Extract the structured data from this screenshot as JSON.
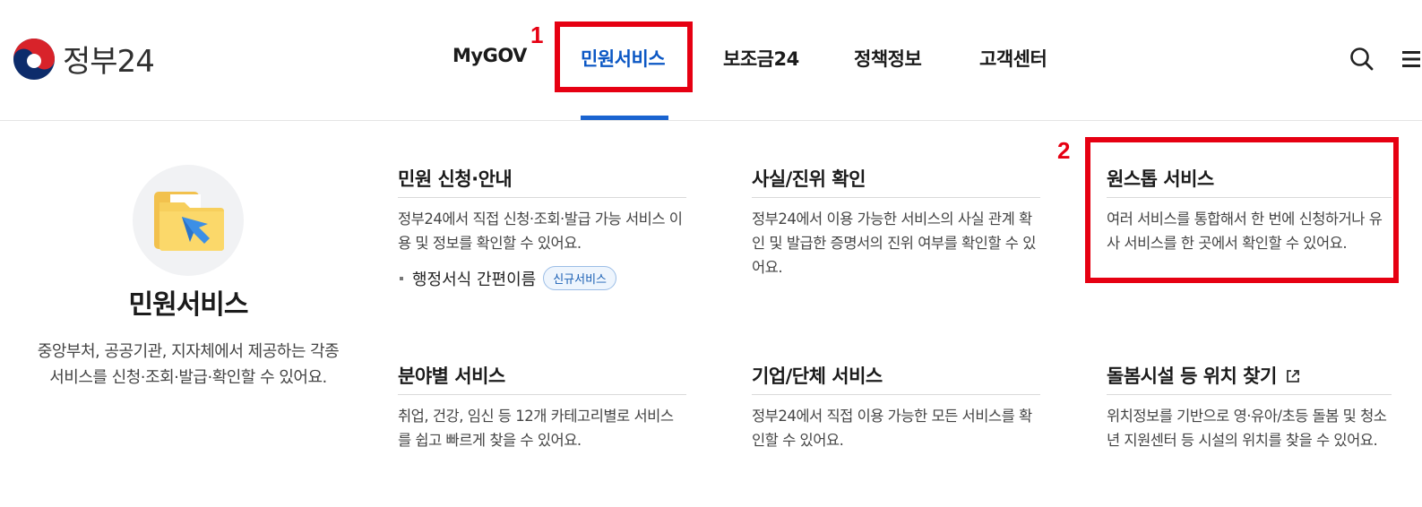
{
  "header": {
    "logo_text": "정부24",
    "nav": [
      {
        "label": "MyGOV"
      },
      {
        "label": "민원서비스"
      },
      {
        "label": "보조금24"
      },
      {
        "label": "정책정보"
      },
      {
        "label": "고객센터"
      }
    ],
    "active_tab": "민원서비스",
    "icons": [
      "search-icon",
      "menu-icon"
    ]
  },
  "annotations": [
    {
      "number": "1",
      "target": "민원서비스"
    },
    {
      "number": "2",
      "target": "원스톱 서비스"
    }
  ],
  "intro": {
    "title": "민원서비스",
    "desc": "중앙부처, 공공기관, 지자체에서 제공하는 각종 서비스를 신청·조회·발급·확인할 수 있어요."
  },
  "cards": [
    {
      "title": "민원 신청·안내",
      "desc": "정부24에서 직접 신청·조회·발급 가능 서비스 이용 및 정보를 확인할 수 있어요.",
      "sublink": "행정서식 간편이름",
      "badge": "신규서비스"
    },
    {
      "title": "사실/진위 확인",
      "desc": "정부24에서 이용 가능한 서비스의 사실 관계 확인 및 발급한 증명서의 진위 여부를 확인할 수 있어요."
    },
    {
      "title": "원스톱 서비스",
      "desc": "여러 서비스를 통합해서 한 번에 신청하거나 유사 서비스를 한 곳에서 확인할 수 있어요."
    },
    {
      "title": "분야별 서비스",
      "desc": "취업, 건강, 임신 등 12개 카테고리별로 서비스를 쉽고 빠르게 찾을 수 있어요."
    },
    {
      "title": "기업/단체 서비스",
      "desc": "정부24에서 직접 이용 가능한 모든 서비스를 확인할 수 있어요."
    },
    {
      "title": "돌봄시설 등 위치 찾기",
      "desc": "위치정보를 기반으로 영·유아/초등 돌봄 및 청소년 지원센터 등 시설의 위치를 찾을 수 있어요."
    }
  ],
  "colors": {
    "accent": "#0b57c4",
    "annotation": "#e60012",
    "badge_bg": "#eef5fd"
  }
}
